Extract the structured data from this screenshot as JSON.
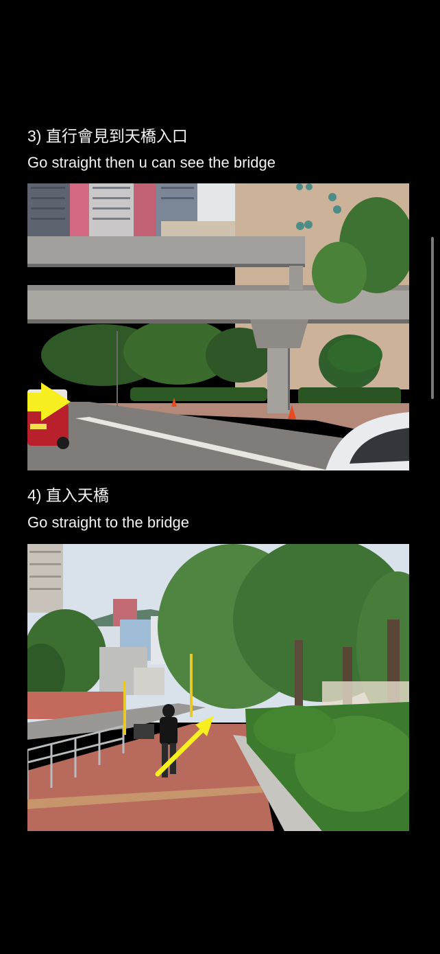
{
  "steps": [
    {
      "number": "3)",
      "title_zh": "直行會見到天橋入口",
      "title_en": "Go straight then u can see the bridge",
      "photo_icon": "photo-footbridge-overpass",
      "arrow_icon": "yellow-arrow-right-icon"
    },
    {
      "number": "4)",
      "title_zh": "直入天橋",
      "title_en": "Go straight to the bridge",
      "photo_icon": "photo-brick-sidewalk",
      "arrow_icon": "yellow-arrow-diagonal-icon"
    }
  ],
  "colors": {
    "background": "#000000",
    "arrow": "#f7ef1f",
    "text": "#f2f2f2"
  }
}
